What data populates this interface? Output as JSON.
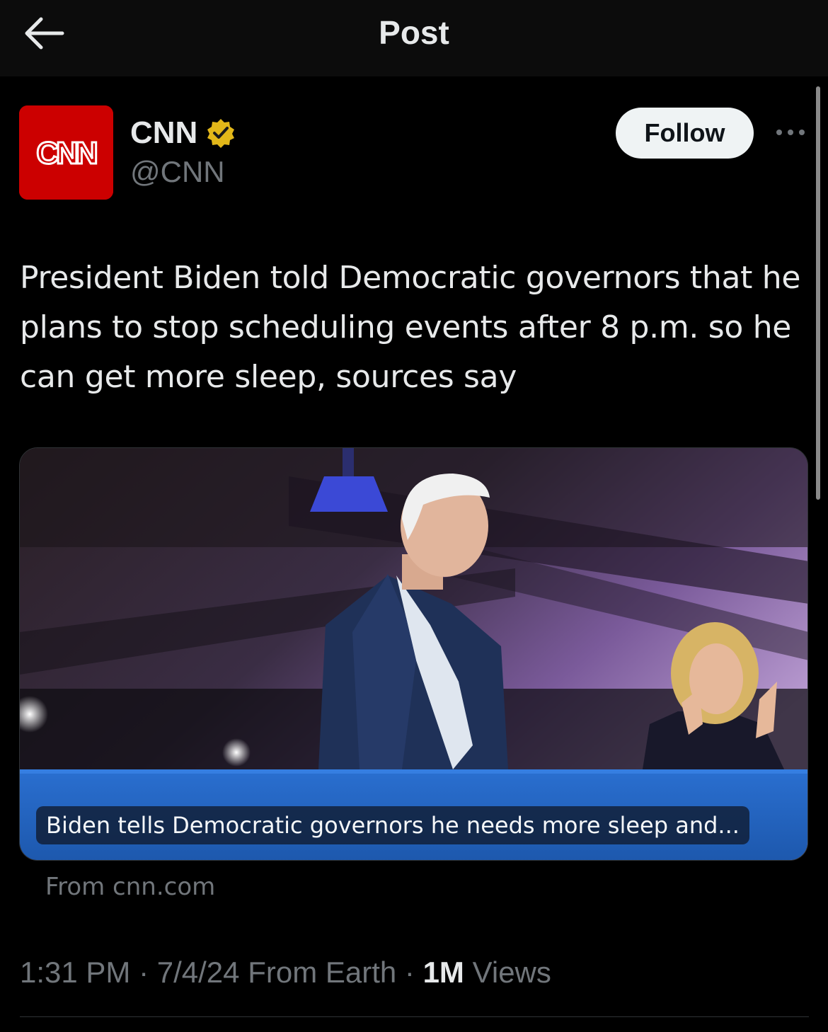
{
  "header": {
    "title": "Post",
    "back_icon": "arrow-left-icon"
  },
  "author": {
    "name": "CNN",
    "handle": "@CNN",
    "avatar_text": "CNN",
    "verified_icon": "verified-badge-icon",
    "verified_color": "#e2b719",
    "avatar_color": "#cc0000"
  },
  "actions": {
    "follow_label": "Follow",
    "more_icon": "more-horizontal-icon"
  },
  "tweet": {
    "text": "President Biden told Democratic governors that he plans to stop scheduling events after 8 p.m. so he can get more sleep, sources say"
  },
  "link_card": {
    "headline": "Biden tells Democratic governors he needs more sleep and...",
    "source": "From cnn.com"
  },
  "meta": {
    "time": "1:31 PM",
    "separator": " · ",
    "date": "7/4/24",
    "location": "From Earth",
    "views_count": "1M",
    "views_label": "Views"
  },
  "colors": {
    "background": "#000000",
    "text_primary": "#e7e9ea",
    "text_secondary": "#71767b",
    "follow_bg": "#eff3f4"
  }
}
